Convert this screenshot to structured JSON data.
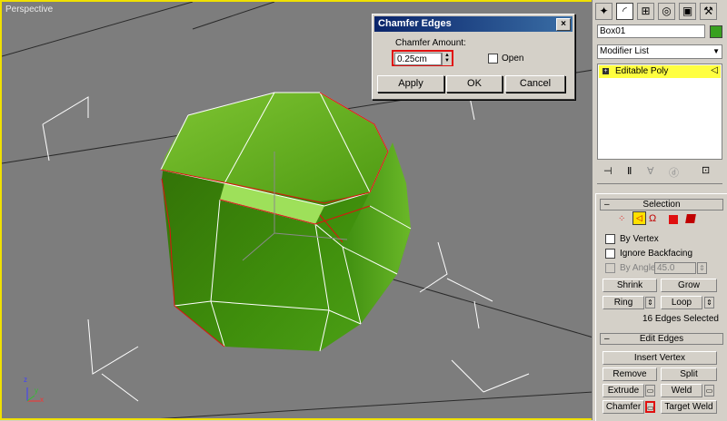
{
  "viewport": {
    "label": "Perspective",
    "axis_x": "x",
    "axis_y": "y",
    "axis_z": "z"
  },
  "dialog": {
    "title": "Chamfer Edges",
    "close_label": "×",
    "amount_label": "Chamfer Amount:",
    "amount_value": "0.25cm",
    "open_label": "Open",
    "open_checked": false,
    "apply_label": "Apply",
    "ok_label": "OK",
    "cancel_label": "Cancel"
  },
  "panel": {
    "tabs": [
      "create-icon",
      "modify-icon",
      "hierarchy-icon",
      "motion-icon",
      "display-icon",
      "utilities-icon"
    ],
    "object_name": "Box01",
    "object_color": "#38a020",
    "modifier_list_label": "Modifier List",
    "stack": [
      {
        "label": "Editable Poly",
        "selected": true
      }
    ],
    "selection": {
      "title": "Selection",
      "by_vertex_label": "By Vertex",
      "ignore_backfacing_label": "Ignore Backfacing",
      "by_angle_label": "By Angle:",
      "by_angle_value": "45.0",
      "shrink_label": "Shrink",
      "grow_label": "Grow",
      "ring_label": "Ring",
      "loop_label": "Loop",
      "status": "16 Edges Selected"
    },
    "edit_edges": {
      "title": "Edit Edges",
      "insert_vertex_label": "Insert Vertex",
      "remove_label": "Remove",
      "split_label": "Split",
      "extrude_label": "Extrude",
      "weld_label": "Weld",
      "chamfer_label": "Chamfer",
      "target_weld_label": "Target Weld"
    }
  }
}
